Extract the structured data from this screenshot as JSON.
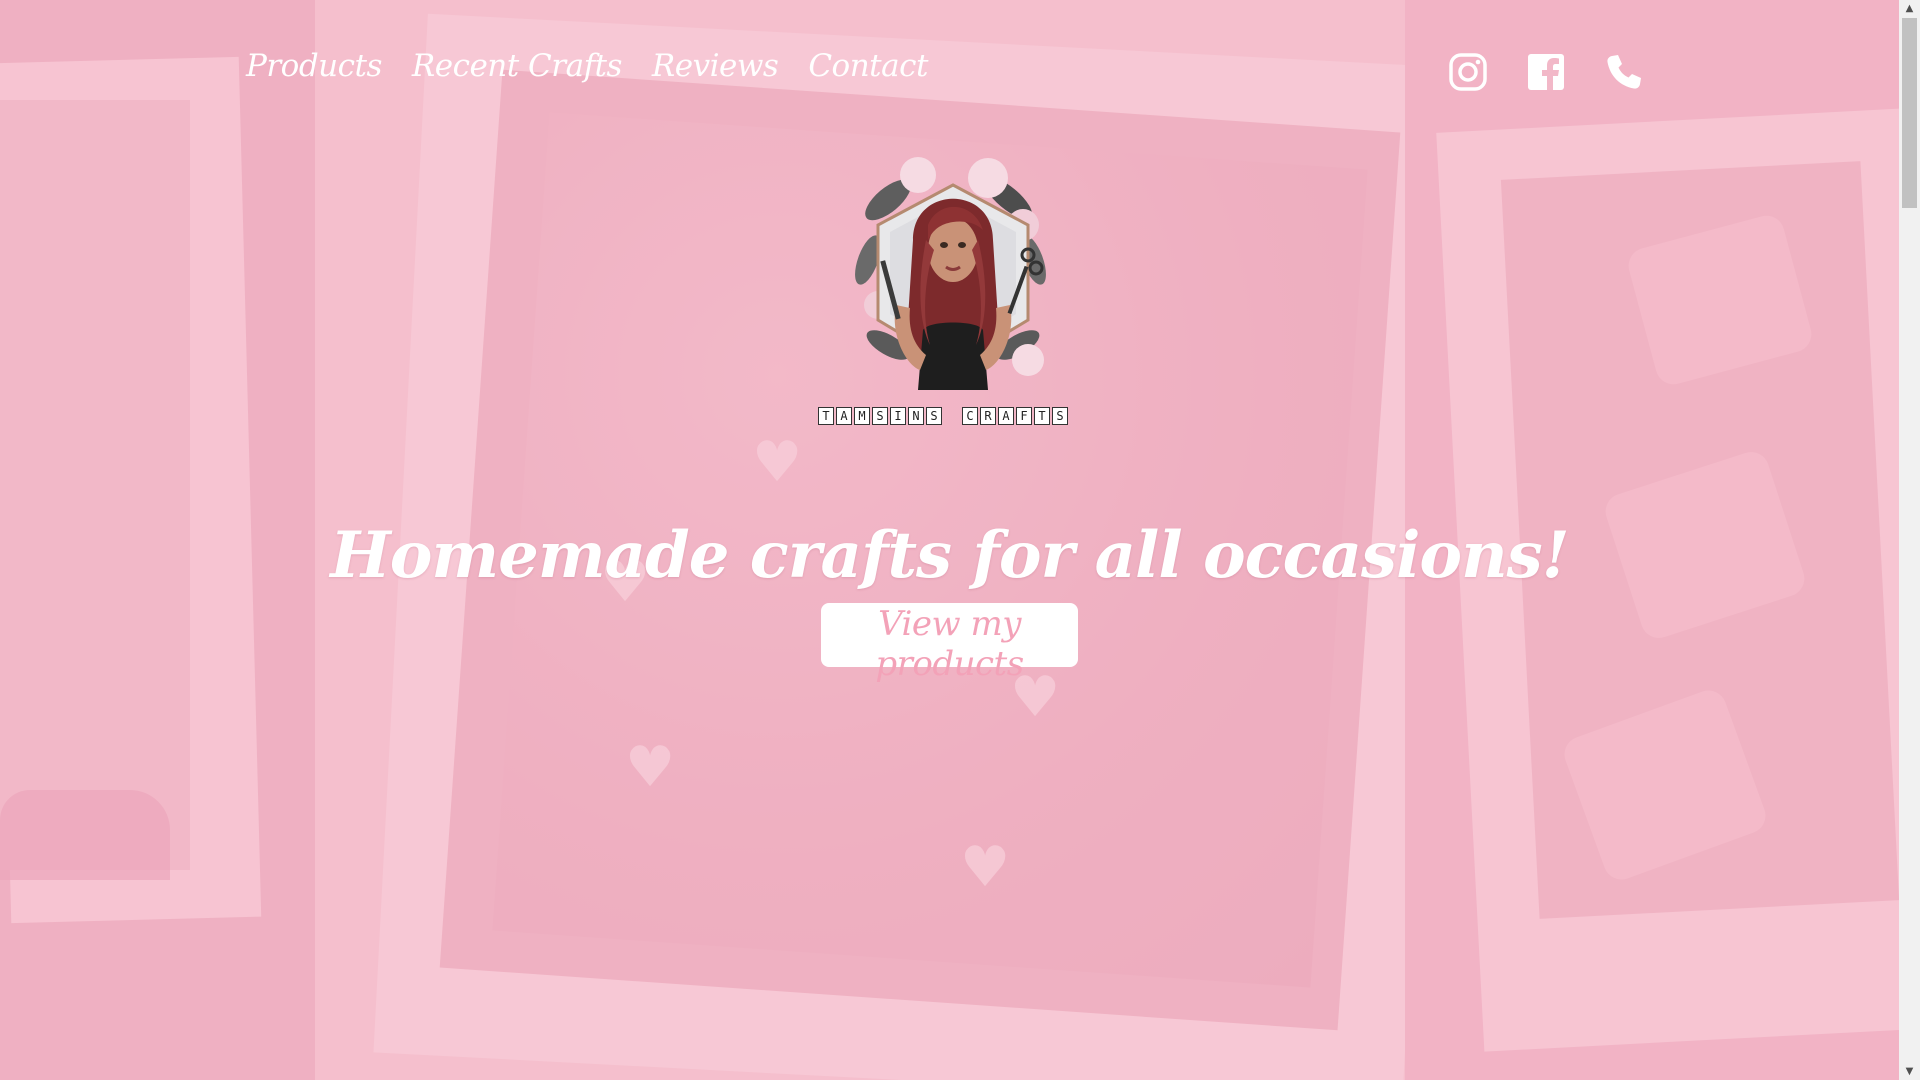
{
  "nav": {
    "items": [
      {
        "label": "Products"
      },
      {
        "label": "Recent Crafts"
      },
      {
        "label": "Reviews"
      },
      {
        "label": "Contact"
      }
    ]
  },
  "social": {
    "icons": [
      "instagram-icon",
      "facebook-icon",
      "phone-icon"
    ]
  },
  "logo": {
    "tiles": [
      "T",
      "A",
      "M",
      "S",
      "I",
      "N",
      "S",
      "",
      "C",
      "R",
      "A",
      "F",
      "T",
      "S"
    ]
  },
  "hero": {
    "headline": "Homemade crafts for all occasions!",
    "cta_label": "View my products"
  },
  "colors": {
    "background_pink": "#f2b8c8",
    "cta_text": "#f3a2b8",
    "white": "#ffffff"
  }
}
